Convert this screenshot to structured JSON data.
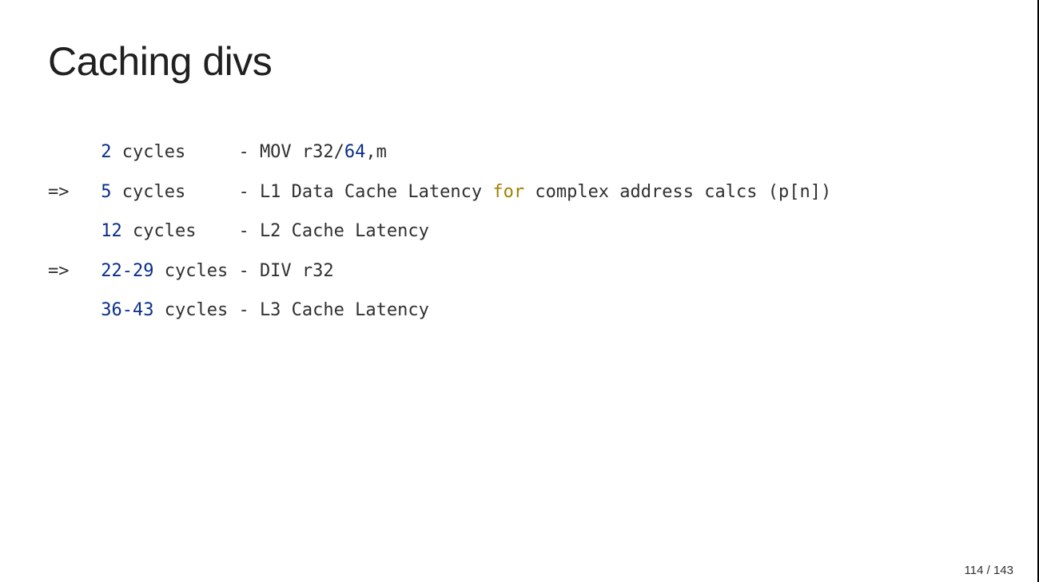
{
  "title": "Caching divs",
  "rows": [
    {
      "marker": "  ",
      "cycles_num": "2",
      "cycles_word": " cycles     ",
      "sep": "- ",
      "pre": "MOV r32/",
      "num2": "64",
      "mid": ",m",
      "kw": "",
      "post": ""
    },
    {
      "marker": "=>",
      "cycles_num": "5",
      "cycles_word": " cycles     ",
      "sep": "- ",
      "pre": "L1 Data Cache Latency ",
      "num2": "",
      "mid": "",
      "kw": "for",
      "post": " complex address calcs (p[n])"
    },
    {
      "marker": "  ",
      "cycles_num": "12",
      "cycles_word": " cycles    ",
      "sep": "- ",
      "pre": "L2 Cache Latency",
      "num2": "",
      "mid": "",
      "kw": "",
      "post": ""
    },
    {
      "marker": "=>",
      "cycles_num": "22-29",
      "cycles_word": " cycles ",
      "sep": "- ",
      "pre": "DIV r32",
      "num2": "",
      "mid": "",
      "kw": "",
      "post": ""
    },
    {
      "marker": "  ",
      "cycles_num": "36-43",
      "cycles_word": " cycles ",
      "sep": "- ",
      "pre": "L3 Cache Latency",
      "num2": "",
      "mid": "",
      "kw": "",
      "post": ""
    }
  ],
  "page": "114 / 143"
}
